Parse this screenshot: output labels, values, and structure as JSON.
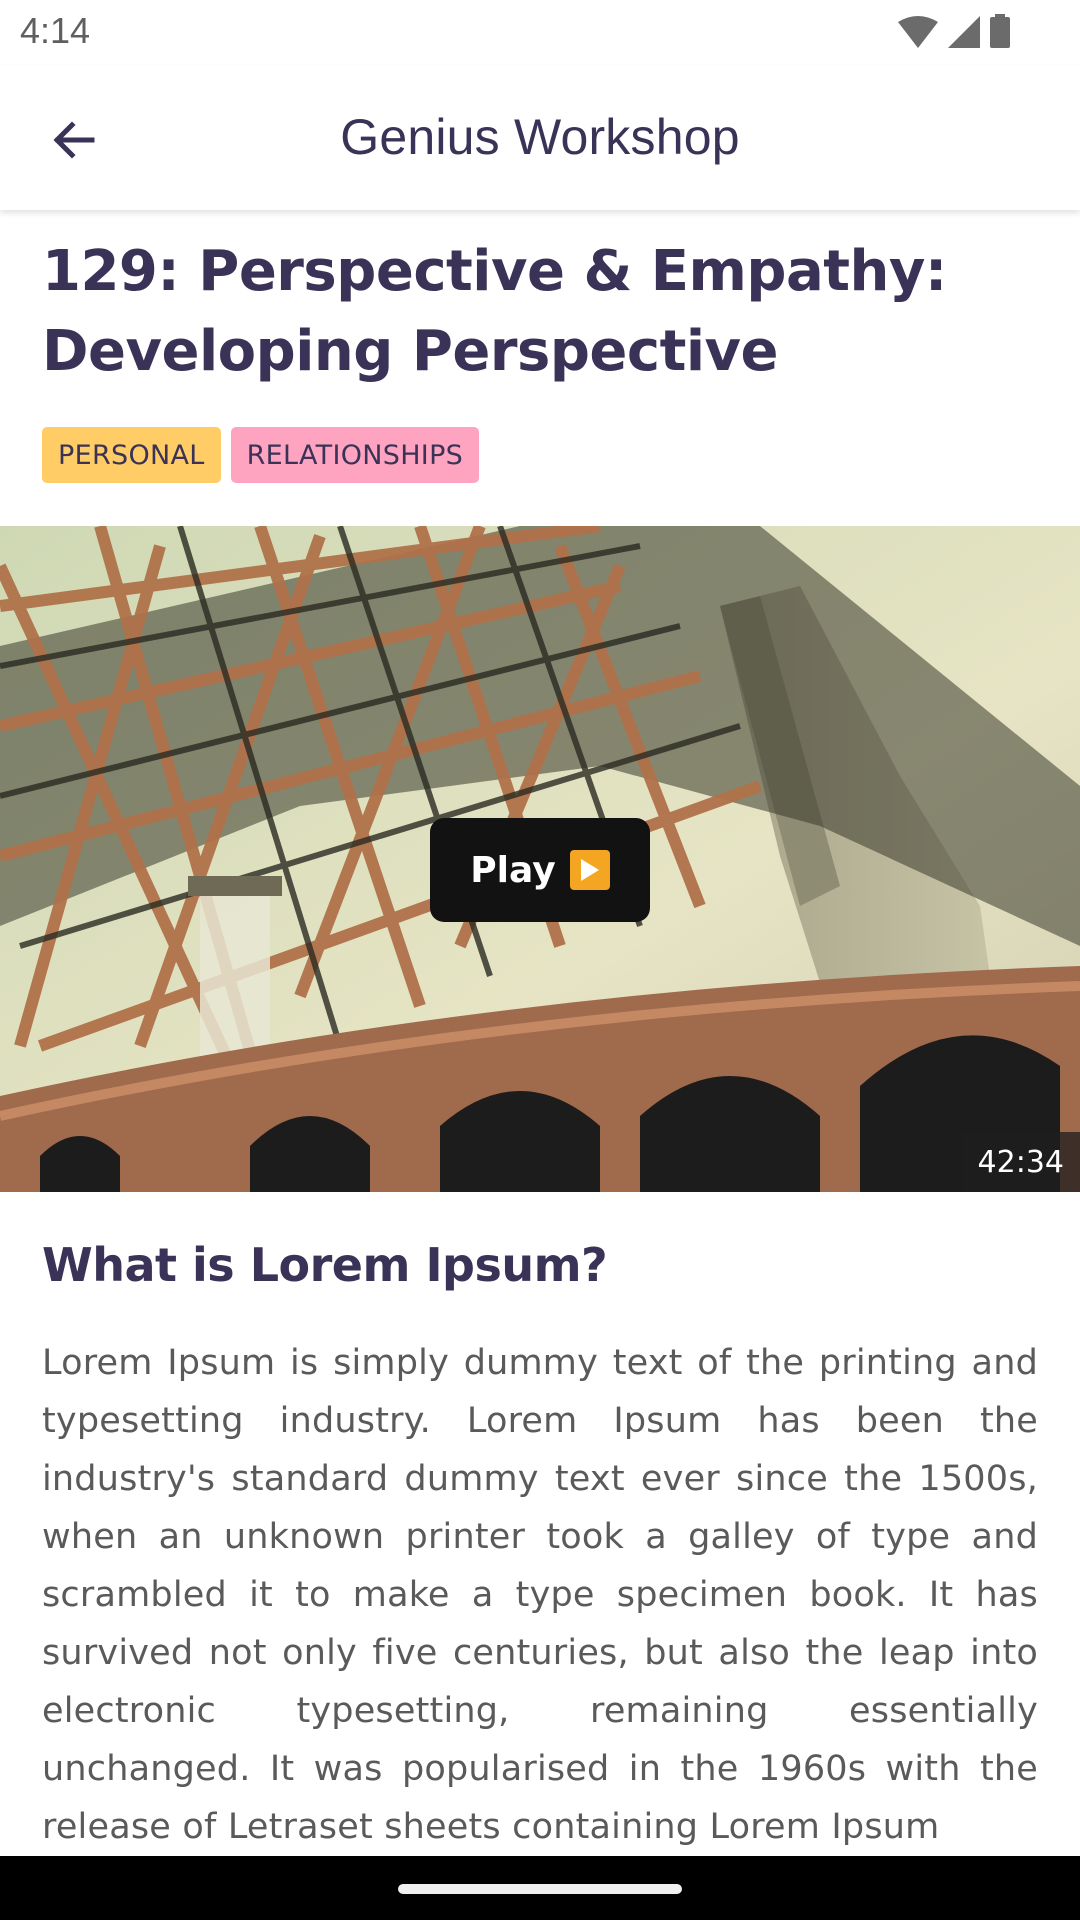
{
  "status_bar": {
    "time": "4:14",
    "icons": [
      "wifi-icon",
      "signal-icon",
      "battery-icon"
    ]
  },
  "app_bar": {
    "title": "Genius Workshop",
    "back_icon": "arrow-back-icon"
  },
  "episode": {
    "title": "129: Perspective & Empathy: Developing Perspective",
    "tags": [
      {
        "label": "PERSONAL",
        "color": "#ffcc66"
      },
      {
        "label": "RELATIONSHIPS",
        "color": "#ffa4c0"
      }
    ]
  },
  "video": {
    "play_label": "Play",
    "play_icon": "play-icon",
    "duration": "42:34"
  },
  "description": {
    "heading": "What is Lorem Ipsum?",
    "body": "Lorem Ipsum is simply dummy text of the printing and typesetting industry. Lorem Ipsum has been the industry's standard dummy text ever since the 1500s, when an unknown printer took a galley of type and scrambled it to make a type specimen book. It has survived not only five centuries, but also the leap into electronic typesetting, remaining essentially unchanged. It was popularised in the 1960s with the release of Letraset sheets containing Lorem Ipsum"
  },
  "colors": {
    "primary_text": "#3a3357",
    "body_text": "#5a5a5a",
    "tag_personal": "#ffcc66",
    "tag_relationships": "#ffa4c0"
  }
}
